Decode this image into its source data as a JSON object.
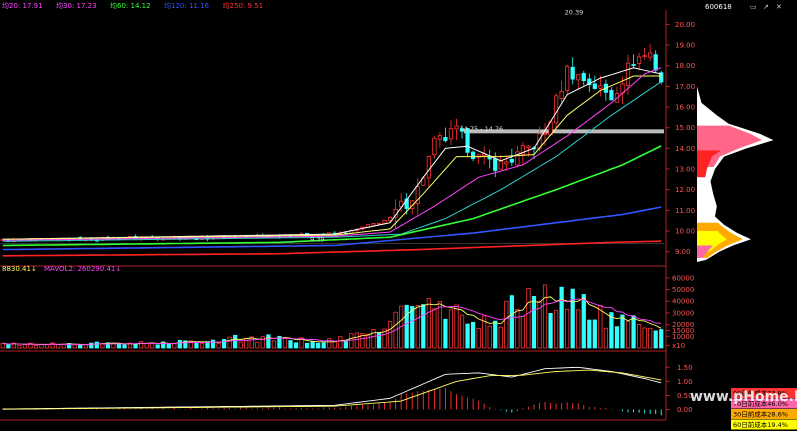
{
  "header": {
    "ma_legend": [
      {
        "text": "均20: 17.91",
        "color": "#ff44ff"
      },
      {
        "text": "均30: 17.23",
        "color": "#ff44ff"
      },
      {
        "text": "均60: 14.12",
        "color": "#33ff33"
      },
      {
        "text": "均120: 11.16",
        "color": "#3355ff"
      },
      {
        "text": "均250: 9.51",
        "color": "#ff3333"
      }
    ],
    "stock_code": "600618"
  },
  "watermark": "www.pHome.NET",
  "colors": {
    "up": "#ff3333",
    "down": "#33ffff",
    "ma5": "#ffffff",
    "ma10": "#ffff66",
    "ma20": "#ff44ff",
    "ma30": "#33cccc",
    "ma60": "#33ff33",
    "ma120": "#3355ff",
    "ma250": "#ff2222",
    "axis": "#b02020",
    "axis_text": "#ff5555"
  },
  "chart_data": [
    {
      "type": "candlestick",
      "y_ticks": [
        "20.00",
        "19.00",
        "18.00",
        "17.00",
        "16.00",
        "15.00",
        "14.00",
        "13.00",
        "12.00",
        "11.00",
        "10.00",
        "9.00"
      ],
      "ylim": [
        8.5,
        20.6
      ],
      "bars": 120,
      "price_path": [
        [
          0,
          9.55
        ],
        [
          15,
          9.6
        ],
        [
          25,
          9.7
        ],
        [
          35,
          9.65
        ],
        [
          45,
          9.75
        ],
        [
          55,
          9.8
        ],
        [
          62,
          9.9
        ],
        [
          70,
          10.6
        ],
        [
          75,
          12.0
        ],
        [
          78,
          14.2
        ],
        [
          82,
          14.8
        ],
        [
          86,
          13.5
        ],
        [
          90,
          13.2
        ],
        [
          94,
          13.8
        ],
        [
          98,
          14.7
        ],
        [
          102,
          17.8
        ],
        [
          106,
          17.2
        ],
        [
          110,
          16.5
        ],
        [
          114,
          18.3
        ],
        [
          117,
          18.6
        ],
        [
          119,
          17.3
        ]
      ],
      "labels": [
        {
          "text": "20.39",
          "price": 20.39,
          "bar": 101
        },
        {
          "text": "14.75 - 14.76",
          "price": 14.75,
          "bar": 82
        },
        {
          "text": "9.39",
          "price": 9.39,
          "bar": 55
        }
      ],
      "moving_averages": [
        {
          "name": "MA5",
          "color_key": "ma5",
          "points": [
            [
              0,
              9.6
            ],
            [
              60,
              9.85
            ],
            [
              70,
              10.4
            ],
            [
              76,
              12.6
            ],
            [
              80,
              14.0
            ],
            [
              84,
              14.1
            ],
            [
              90,
              13.4
            ],
            [
              96,
              14.0
            ],
            [
              102,
              16.6
            ],
            [
              108,
              17.4
            ],
            [
              114,
              17.9
            ],
            [
              119,
              17.6
            ]
          ]
        },
        {
          "name": "MA10",
          "color_key": "ma10",
          "points": [
            [
              0,
              9.6
            ],
            [
              60,
              9.8
            ],
            [
              70,
              10.1
            ],
            [
              76,
              11.8
            ],
            [
              82,
              13.6
            ],
            [
              90,
              13.6
            ],
            [
              96,
              13.7
            ],
            [
              102,
              15.6
            ],
            [
              108,
              16.8
            ],
            [
              114,
              17.5
            ],
            [
              119,
              17.5
            ]
          ]
        },
        {
          "name": "MA20",
          "color_key": "ma20",
          "points": [
            [
              0,
              9.55
            ],
            [
              60,
              9.75
            ],
            [
              70,
              9.95
            ],
            [
              78,
              11.2
            ],
            [
              86,
              12.6
            ],
            [
              94,
              13.2
            ],
            [
              102,
              14.6
            ],
            [
              110,
              16.2
            ],
            [
              116,
              17.6
            ],
            [
              119,
              17.91
            ]
          ]
        },
        {
          "name": "MA30",
          "color_key": "ma30",
          "points": [
            [
              0,
              9.5
            ],
            [
              60,
              9.7
            ],
            [
              72,
              9.85
            ],
            [
              80,
              10.6
            ],
            [
              90,
              12.0
            ],
            [
              100,
              13.6
            ],
            [
              110,
              15.6
            ],
            [
              119,
              17.23
            ]
          ]
        },
        {
          "name": "MA60",
          "color_key": "ma60",
          "points": [
            [
              0,
              9.3
            ],
            [
              50,
              9.45
            ],
            [
              70,
              9.7
            ],
            [
              85,
              10.6
            ],
            [
              100,
              12.0
            ],
            [
              112,
              13.2
            ],
            [
              119,
              14.12
            ]
          ]
        },
        {
          "name": "MA120",
          "color_key": "ma120",
          "points": [
            [
              0,
              9.1
            ],
            [
              60,
              9.3
            ],
            [
              85,
              9.9
            ],
            [
              100,
              10.4
            ],
            [
              112,
              10.8
            ],
            [
              119,
              11.16
            ]
          ]
        },
        {
          "name": "MA250",
          "color_key": "ma250",
          "points": [
            [
              0,
              8.8
            ],
            [
              50,
              8.9
            ],
            [
              75,
              9.1
            ],
            [
              95,
              9.3
            ],
            [
              110,
              9.45
            ],
            [
              119,
              9.51
            ]
          ]
        }
      ]
    },
    {
      "type": "bar",
      "title": "VOL",
      "legend": [
        {
          "text": "8830.41↓",
          "color": "#ffff66"
        },
        {
          "text": "MAVOL2: 260290.41↓",
          "color": "#ff44ff"
        }
      ],
      "y_ticks": [
        "60000",
        "50000",
        "40000",
        "30000",
        "20000",
        "15000",
        "10000",
        "x10"
      ],
      "ylim": [
        0,
        65000
      ],
      "volume_path": [
        [
          0,
          3000
        ],
        [
          30,
          4000
        ],
        [
          45,
          9000
        ],
        [
          55,
          6000
        ],
        [
          62,
          7000
        ],
        [
          66,
          14000
        ],
        [
          70,
          24000
        ],
        [
          76,
          38000
        ],
        [
          80,
          30000
        ],
        [
          86,
          20000
        ],
        [
          92,
          33000
        ],
        [
          96,
          50000
        ],
        [
          100,
          36000
        ],
        [
          104,
          44000
        ],
        [
          110,
          22000
        ],
        [
          116,
          19000
        ],
        [
          119,
          16000
        ]
      ]
    },
    {
      "type": "line",
      "title": "MACD",
      "y_ticks": [
        "1.50",
        "1.00",
        "0.50",
        "0.00"
      ],
      "ylim": [
        -0.3,
        1.9
      ],
      "macd_points": [
        [
          0,
          0.02
        ],
        [
          60,
          0.15
        ],
        [
          70,
          0.4
        ],
        [
          80,
          1.25
        ],
        [
          86,
          1.3
        ],
        [
          92,
          1.15
        ],
        [
          98,
          1.45
        ],
        [
          104,
          1.5
        ],
        [
          110,
          1.35
        ],
        [
          116,
          1.1
        ],
        [
          119,
          0.95
        ]
      ],
      "signal_points": [
        [
          0,
          0.01
        ],
        [
          60,
          0.12
        ],
        [
          72,
          0.3
        ],
        [
          82,
          1.0
        ],
        [
          88,
          1.2
        ],
        [
          94,
          1.22
        ],
        [
          100,
          1.35
        ],
        [
          106,
          1.4
        ],
        [
          112,
          1.3
        ],
        [
          119,
          1.05
        ]
      ]
    },
    {
      "type": "area",
      "title": "cost distribution",
      "profile": [
        [
          20.0,
          0
        ],
        [
          17.0,
          0
        ],
        [
          16.2,
          5
        ],
        [
          15.6,
          22
        ],
        [
          15.2,
          35
        ],
        [
          14.7,
          70
        ],
        [
          14.4,
          85
        ],
        [
          14.0,
          55
        ],
        [
          13.6,
          30
        ],
        [
          13.0,
          20
        ],
        [
          12.4,
          15
        ],
        [
          11.8,
          18
        ],
        [
          11.2,
          22
        ],
        [
          10.7,
          20
        ],
        [
          10.3,
          30
        ],
        [
          9.9,
          45
        ],
        [
          9.6,
          60
        ],
        [
          9.3,
          40
        ],
        [
          9.0,
          25
        ],
        [
          8.6,
          10
        ],
        [
          8.5,
          0
        ]
      ],
      "legend": [
        {
          "text": "90日前成本73.8%",
          "color": "#ff3333"
        },
        {
          "text": "70日前成本46.0%",
          "color": "#ff66aa"
        },
        {
          "text": "30日前成本28.6%",
          "color": "#ffaa00"
        },
        {
          "text": "60日前成本19.4%",
          "color": "#ffff00"
        }
      ]
    }
  ]
}
